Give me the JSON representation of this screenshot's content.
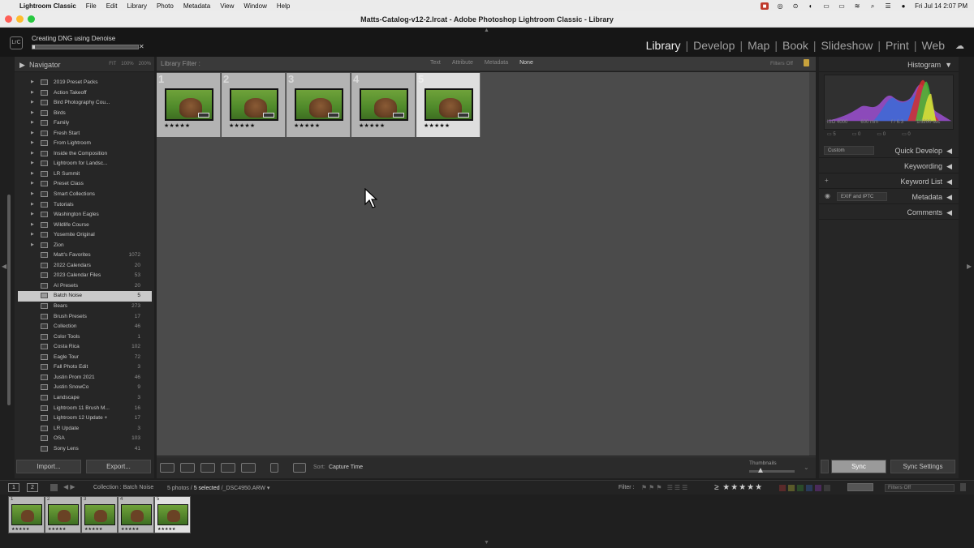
{
  "menubar": {
    "app_name": "Lightroom Classic",
    "items": [
      "File",
      "Edit",
      "Library",
      "Photo",
      "Metadata",
      "View",
      "Window",
      "Help"
    ],
    "clock": "Fri Jul 14  2:07 PM"
  },
  "window": {
    "title": "Matts-Catalog-v12-2.lrcat - Adobe Photoshop Lightroom Classic - Library"
  },
  "identity": {
    "logo": "LrC",
    "task_label": "Creating DNG using Denoise",
    "task_progress": 0.02
  },
  "modules": [
    "Library",
    "Develop",
    "Map",
    "Book",
    "Slideshow",
    "Print",
    "Web"
  ],
  "active_module": "Library",
  "left_panel": {
    "navigator_title": "Navigator",
    "zoom_options": [
      "FIT",
      "100%",
      "200%"
    ],
    "collections": [
      {
        "name": "2019 Preset Packs",
        "count": "",
        "set": true
      },
      {
        "name": "Action Takeoff",
        "count": "",
        "set": true
      },
      {
        "name": "Bird Photography Cou...",
        "count": "",
        "set": true
      },
      {
        "name": "Birds",
        "count": "",
        "set": true
      },
      {
        "name": "Family",
        "count": "",
        "set": true
      },
      {
        "name": "Fresh Start",
        "count": "",
        "set": true
      },
      {
        "name": "From Lightroom",
        "count": "",
        "set": true
      },
      {
        "name": "Inside the Composition",
        "count": "",
        "set": true
      },
      {
        "name": "Lightroom for Landsc...",
        "count": "",
        "set": true
      },
      {
        "name": "LR Summit",
        "count": "",
        "set": true
      },
      {
        "name": "Preset Class",
        "count": "",
        "set": true
      },
      {
        "name": "Smart Collections",
        "count": "",
        "set": true
      },
      {
        "name": "Tutorials",
        "count": "",
        "set": true
      },
      {
        "name": "Washington Eagles",
        "count": "",
        "set": true
      },
      {
        "name": "Wildlife Course",
        "count": "",
        "set": true
      },
      {
        "name": "Yosemite Original",
        "count": "",
        "set": true
      },
      {
        "name": "Zion",
        "count": "",
        "set": true
      },
      {
        "name": "Matt's Favorites",
        "count": "1072",
        "set": false
      },
      {
        "name": "2022 Calendars",
        "count": "20",
        "set": false
      },
      {
        "name": "2023 Calendar Files",
        "count": "53",
        "set": false
      },
      {
        "name": "AI Presets",
        "count": "20",
        "set": false
      },
      {
        "name": "Batch Noise",
        "count": "5",
        "set": false,
        "selected": true
      },
      {
        "name": "Bears",
        "count": "273",
        "set": false
      },
      {
        "name": "Brush Presets",
        "count": "17",
        "set": false
      },
      {
        "name": "Collection",
        "count": "46",
        "set": false
      },
      {
        "name": "Color Tools",
        "count": "1",
        "set": false
      },
      {
        "name": "Costa Rica",
        "count": "102",
        "set": false
      },
      {
        "name": "Eagle Tour",
        "count": "72",
        "set": false
      },
      {
        "name": "Fall Photo Edit",
        "count": "3",
        "set": false
      },
      {
        "name": "Justin Prom 2021",
        "count": "46",
        "set": false
      },
      {
        "name": "Justin SnowCo",
        "count": "9",
        "set": false
      },
      {
        "name": "Landscape",
        "count": "3",
        "set": false
      },
      {
        "name": "Lightroom 11 Brush M...",
        "count": "16",
        "set": false
      },
      {
        "name": "Lightroom 12 Update +",
        "count": "17",
        "set": false
      },
      {
        "name": "LR Update",
        "count": "3",
        "set": false
      },
      {
        "name": "OSA",
        "count": "103",
        "set": false
      },
      {
        "name": "Sony Lens",
        "count": "41",
        "set": false
      }
    ],
    "import_label": "Import...",
    "export_label": "Export..."
  },
  "filter_bar": {
    "label": "Library Filter :",
    "options": [
      "Text",
      "Attribute",
      "Metadata",
      "None"
    ],
    "active_option": "None",
    "filters_off": "Filters Off"
  },
  "grid": {
    "photos": [
      {
        "index": "1",
        "stars": "★★★★★",
        "selected": false
      },
      {
        "index": "2",
        "stars": "★★★★★",
        "selected": false
      },
      {
        "index": "3",
        "stars": "★★★★★",
        "selected": false
      },
      {
        "index": "4",
        "stars": "★★★★★",
        "selected": false
      },
      {
        "index": "5",
        "stars": "★★★★★",
        "selected": true
      }
    ]
  },
  "toolbar": {
    "sort_label": "Sort:",
    "sort_value": "Capture Time",
    "thumbnails_label": "Thumbnails",
    "thumbnail_size": 0.25
  },
  "right_panel": {
    "histogram_title": "Histogram",
    "histo_info": [
      "ISO 4000",
      "600 mm",
      "f / 6.3",
      "1/3200 sec"
    ],
    "histo_icon_values": [
      "5",
      "0",
      "0",
      "0"
    ],
    "quick_develop": "Quick Develop",
    "quick_develop_preset": "Custom",
    "keywording": "Keywording",
    "keyword_list": "Keyword List",
    "keyword_list_icon": "+",
    "metadata": "Metadata",
    "metadata_preset": "EXIF and IPTC",
    "comments": "Comments",
    "sync_label": "Sync",
    "sync_settings_label": "Sync Settings"
  },
  "filmstrip_bar": {
    "screen_1": "1",
    "screen_2": "2",
    "source": "Collection : Batch Noise",
    "count_prefix": "5 photos /",
    "count_selected": "5 selected",
    "filename": "/_DSC4950.ARW",
    "filter_label": "Filter :",
    "rating_op": "≥",
    "rating_stars": "★★★★★",
    "filters_off": "Filters Off"
  },
  "filmstrip": {
    "thumbs": [
      {
        "index": "1",
        "stars": "★★★★★",
        "selected": false
      },
      {
        "index": "2",
        "stars": "★★★★★",
        "selected": false
      },
      {
        "index": "3",
        "stars": "★★★★★",
        "selected": false
      },
      {
        "index": "4",
        "stars": "★★★★★",
        "selected": false
      },
      {
        "index": "5",
        "stars": "★★★★★",
        "selected": true
      }
    ]
  }
}
